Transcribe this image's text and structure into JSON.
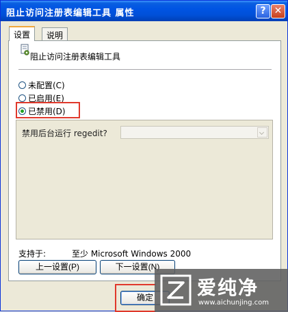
{
  "window": {
    "title": "阻止访问注册表编辑工具 属性",
    "help_glyph": "?",
    "close_glyph": "✕"
  },
  "tabs": [
    {
      "label": "设置",
      "active": true
    },
    {
      "label": "说明",
      "active": false
    }
  ],
  "policy": {
    "name": "阻止访问注册表编辑工具",
    "icon": "policy-setting-icon"
  },
  "radios": [
    {
      "label": "未配置(C)",
      "checked": false
    },
    {
      "label": "已启用(E)",
      "checked": false
    },
    {
      "label": "已禁用(D)",
      "checked": true
    }
  ],
  "options": {
    "label": "禁用后台运行 regedit?",
    "select_value": ""
  },
  "support": {
    "label": "支持于:",
    "value": "至少 Microsoft Windows 2000"
  },
  "buttons": {
    "prev": "上一设置(P)",
    "next": "下一设置(N)",
    "ok": "确定"
  },
  "watermark": {
    "text": "爱纯净",
    "url": "www.aichunjing.com"
  },
  "colors": {
    "highlight": "#e0382b",
    "titlebar": "#0054e3"
  }
}
